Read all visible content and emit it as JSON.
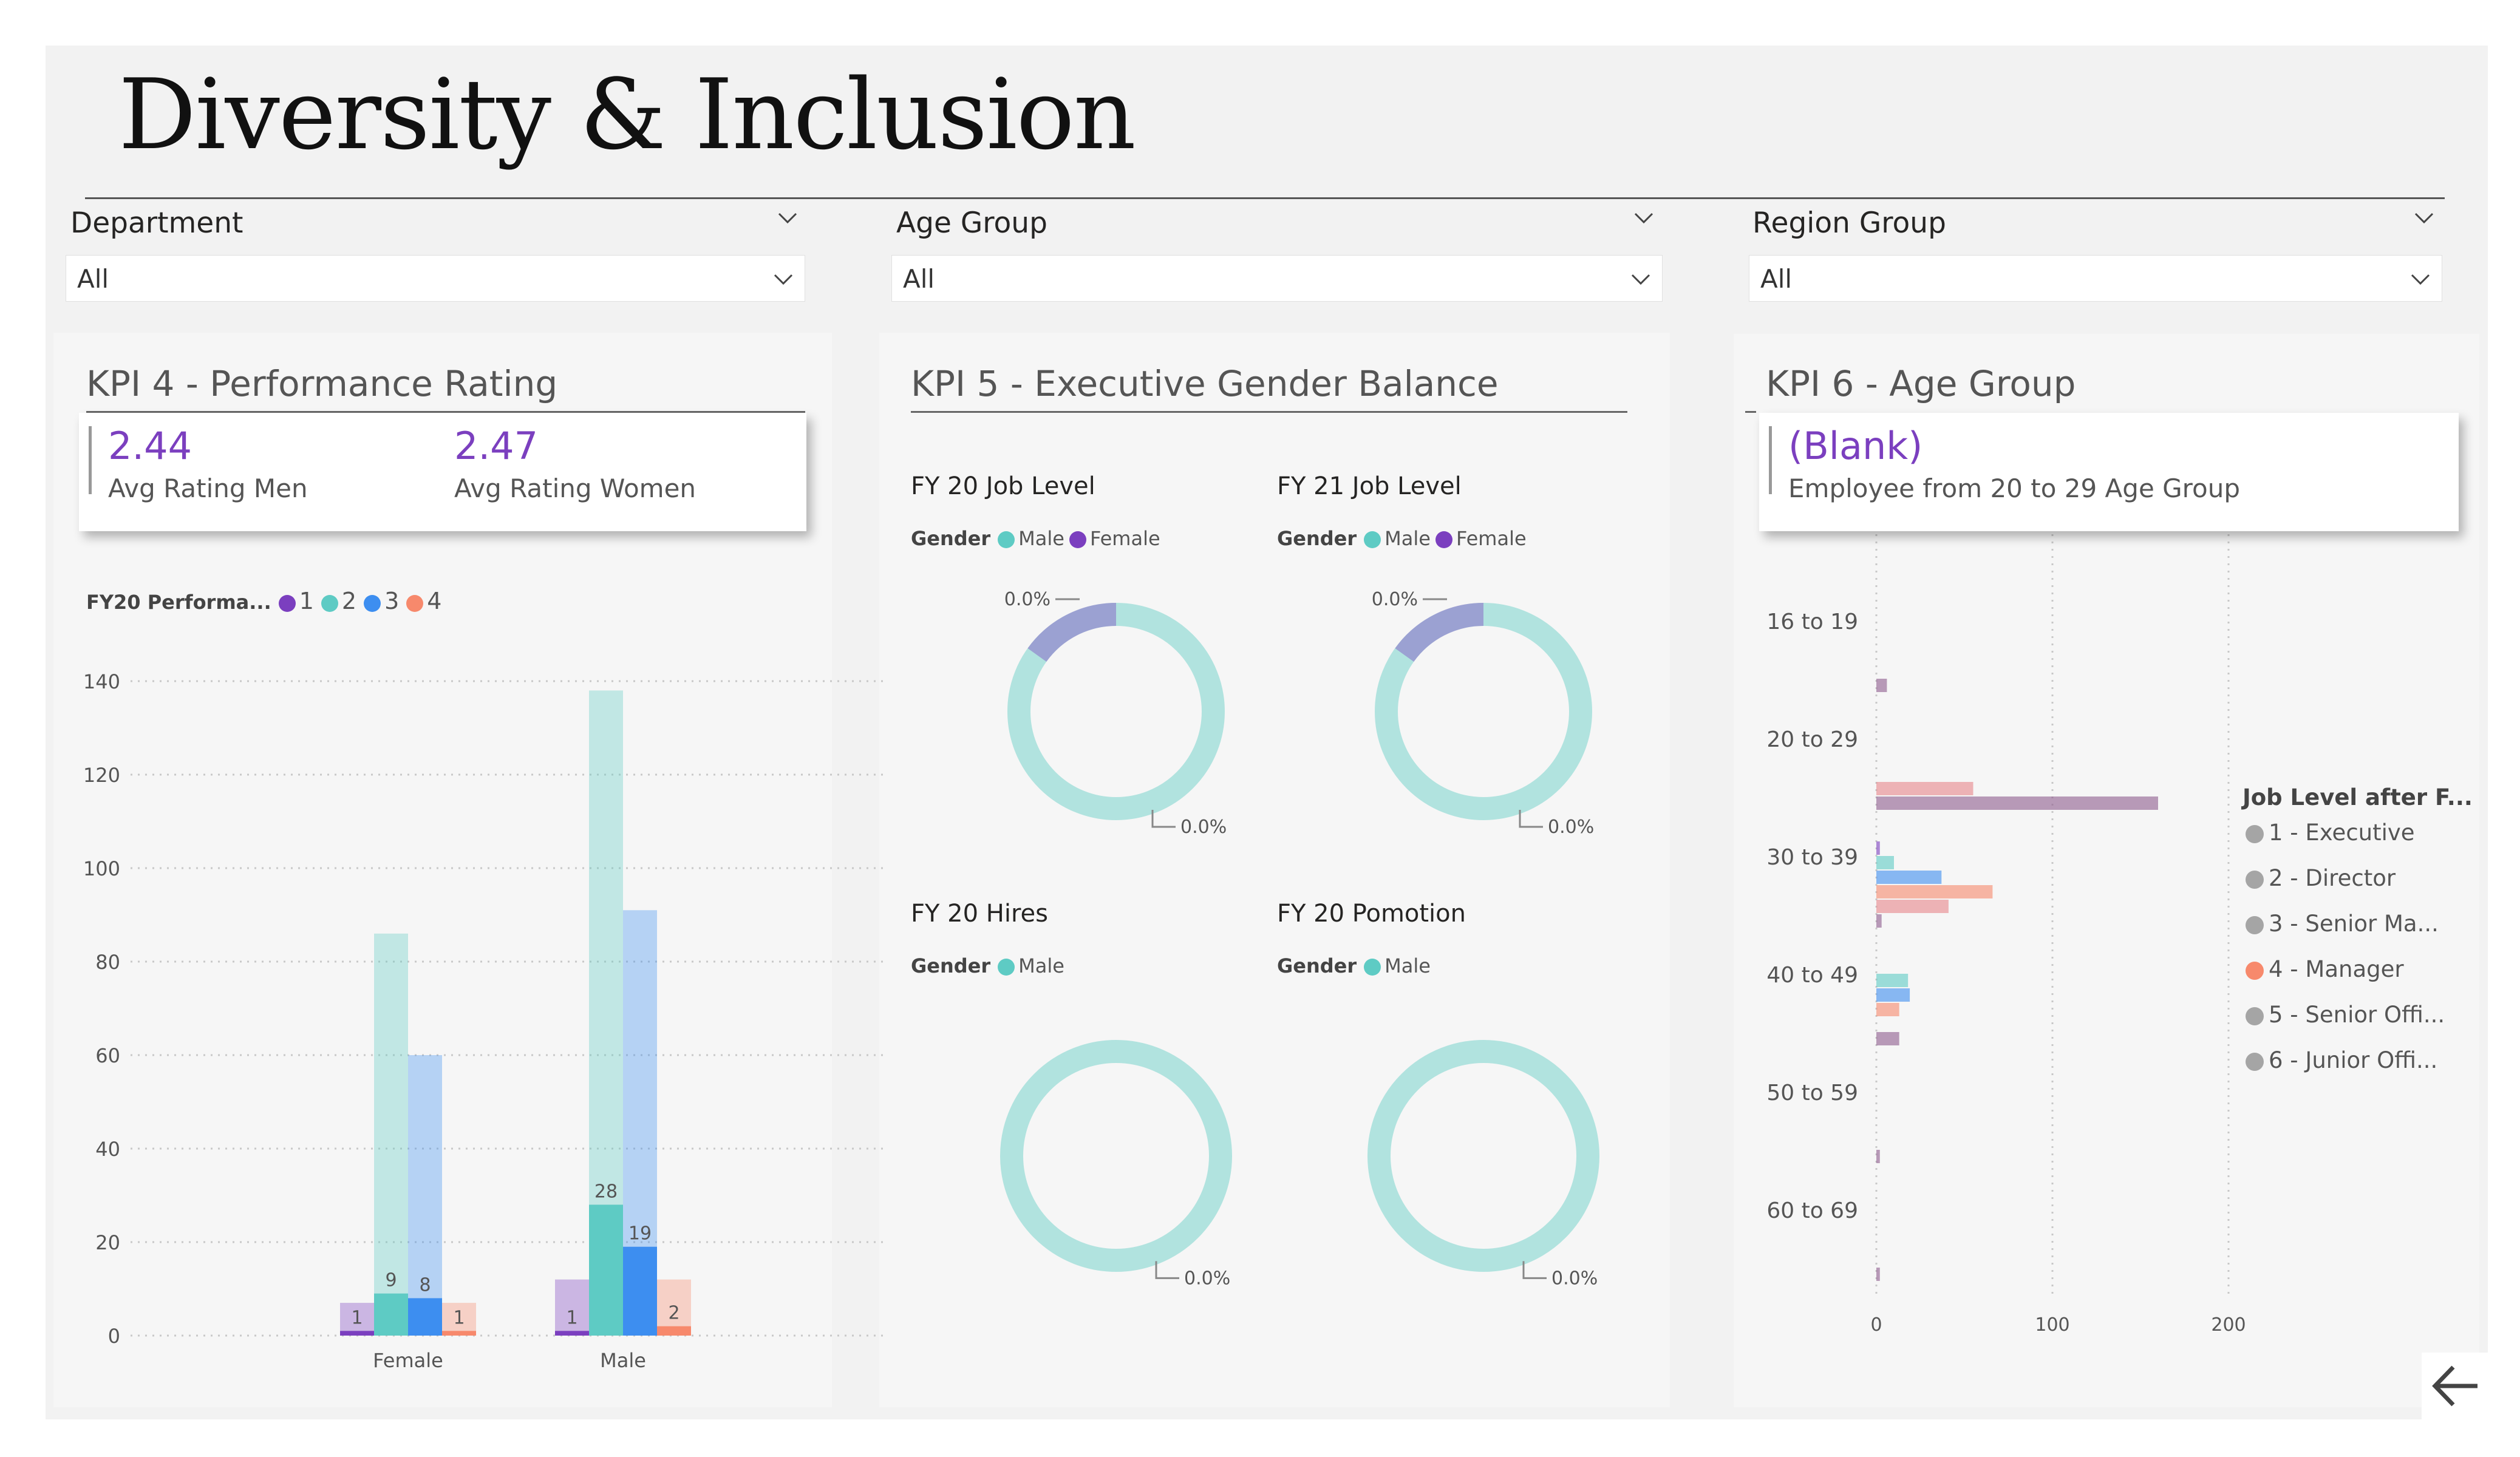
{
  "title": "Diversity & Inclusion",
  "slicers": [
    {
      "title": "Department",
      "value": "All"
    },
    {
      "title": "Age Group",
      "value": "All"
    },
    {
      "title": "Region Group",
      "value": "All"
    }
  ],
  "kpi4": {
    "title": "KPI 4 - Performance Rating",
    "men_value": "2.44",
    "men_label": "Avg Rating Men",
    "women_value": "2.47",
    "women_label": "Avg Rating Women",
    "legend_title": "FY20 Performa...",
    "legend": [
      "1",
      "2",
      "3",
      "4"
    ],
    "colors": {
      "1": "#7b3fbf",
      "2": "#5ecbc4",
      "3": "#3d8ef0",
      "4": "#f7896c"
    }
  },
  "kpi5": {
    "title": "KPI 5 - Executive Gender Balance",
    "donuts": [
      {
        "title": "FY 20 Job Level",
        "legend_label": "Gender",
        "legend": [
          "Male",
          "Female"
        ],
        "label_top": "0.0%",
        "label_bottom": "0.0%"
      },
      {
        "title": "FY 21 Job Level",
        "legend_label": "Gender",
        "legend": [
          "Male",
          "Female"
        ],
        "label_top": "0.0%",
        "label_bottom": "0.0%"
      },
      {
        "title": "FY 20 Hires",
        "legend_label": "Gender",
        "legend": [
          "Male"
        ],
        "label_bottom": "0.0%"
      },
      {
        "title": "FY 20 Pomotion",
        "legend_label": "Gender",
        "legend": [
          "Male"
        ],
        "label_bottom": "0.0%"
      }
    ],
    "colors": {
      "Male": "#5ecbc4",
      "Female": "#7b3fbf"
    }
  },
  "kpi6": {
    "title": "KPI 6 - Age Group",
    "card_value": "(Blank)",
    "card_label": "Employee from 20 to 29 Age Group",
    "legend_title": "Job Level after F...",
    "legend": [
      {
        "label": "1 - Executive",
        "color": "#a5a5a5"
      },
      {
        "label": "2 - Director",
        "color": "#a5a5a5"
      },
      {
        "label": "3 - Senior Ma...",
        "color": "#a5a5a5"
      },
      {
        "label": "4 - Manager",
        "color": "#f7896c"
      },
      {
        "label": "5 - Senior Offi...",
        "color": "#a5a5a5"
      },
      {
        "label": "6 - Junior Offi...",
        "color": "#a5a5a5"
      }
    ]
  },
  "chart_data": [
    {
      "type": "bar",
      "title": "FY20 Performa...",
      "categories": [
        "Female",
        "Male"
      ],
      "ylim": [
        0,
        140
      ],
      "yticks": [
        0,
        20,
        40,
        60,
        80,
        100,
        120,
        140
      ],
      "grid": true,
      "series": [
        {
          "name": "1",
          "values": [
            1,
            1
          ],
          "totals": [
            7,
            12
          ],
          "color": "#7b3fbf"
        },
        {
          "name": "2",
          "values": [
            9,
            28
          ],
          "totals": [
            86,
            138
          ],
          "color": "#5ecbc4"
        },
        {
          "name": "3",
          "values": [
            8,
            19
          ],
          "totals": [
            60,
            91
          ],
          "color": "#3d8ef0"
        },
        {
          "name": "4",
          "values": [
            1,
            2
          ],
          "totals": [
            7,
            12
          ],
          "color": "#f7896c"
        }
      ]
    },
    {
      "type": "bar",
      "orientation": "horizontal",
      "title": "Job Level after F...",
      "categories": [
        "16 to 19",
        "20 to 29",
        "30 to 39",
        "40 to 49",
        "50 to 59",
        "60 to 69"
      ],
      "xlim": [
        0,
        230
      ],
      "xticks": [
        0,
        100,
        200
      ],
      "series": [
        {
          "name": "1 - Executive",
          "color": "#7b3fbf",
          "values": [
            0,
            0,
            2,
            0,
            0,
            0
          ]
        },
        {
          "name": "2 - Director",
          "color": "#5ecbc4",
          "values": [
            0,
            0,
            10,
            18,
            0,
            0
          ]
        },
        {
          "name": "3 - Senior Ma...",
          "color": "#3d8ef0",
          "values": [
            0,
            0,
            37,
            19,
            0,
            0
          ]
        },
        {
          "name": "4 - Manager",
          "color": "#f7896c",
          "values": [
            0,
            0,
            66,
            13,
            0,
            0
          ]
        },
        {
          "name": "5 - Senior Offi...",
          "color": "#e8858a",
          "values": [
            0,
            55,
            41,
            0,
            0,
            0
          ]
        },
        {
          "name": "6 - Junior Offi...",
          "color": "#8e5c8e",
          "values": [
            6,
            160,
            3,
            13,
            2,
            2
          ]
        }
      ]
    }
  ]
}
